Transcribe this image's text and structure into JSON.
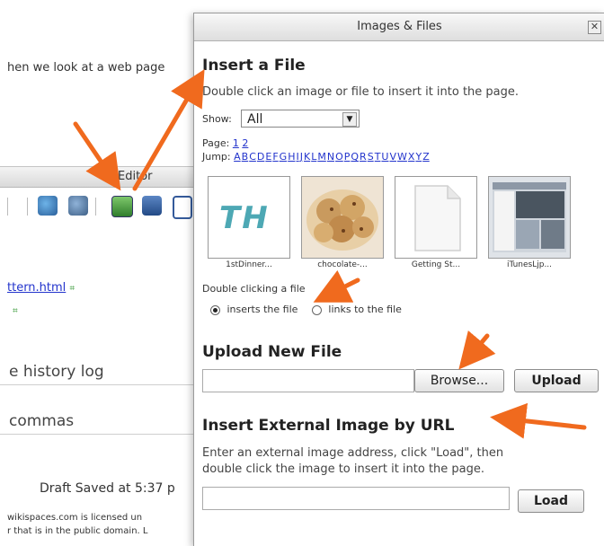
{
  "background": {
    "intro_text": "hen we look at a web page",
    "editor_label": "Editor",
    "link_text": "ttern.html",
    "history_field": "e history log",
    "commas_field": "commas",
    "draft_status": "Draft Saved at 5:37 p",
    "license_line1": "wikispaces.com is licensed un",
    "license_line2": "r that is in the public domain. L"
  },
  "dialog": {
    "title": "Images & Files",
    "close_icon": "close-icon",
    "insert": {
      "heading": "Insert a File",
      "description": "Double click an image or file to insert it into the page.",
      "show_label": "Show:",
      "show_value": "All",
      "page_label": "Page:",
      "pages": [
        "1",
        "2"
      ],
      "jump_label": "Jump:",
      "jump_letters": [
        "A",
        "B",
        "C",
        "D",
        "E",
        "F",
        "G",
        "H",
        "I",
        "J",
        "K",
        "L",
        "M",
        "N",
        "O",
        "P",
        "Q",
        "R",
        "S",
        "T",
        "U",
        "V",
        "W",
        "X",
        "Y",
        "Z"
      ],
      "files": [
        {
          "caption": "1stDinner...",
          "thumb_text": "TH"
        },
        {
          "caption": "chocolate-...",
          "thumb_text": ""
        },
        {
          "caption": "Getting St...",
          "thumb_text": ""
        },
        {
          "caption": "iTunesLjp...",
          "thumb_text": ""
        }
      ],
      "double_click_label": "Double clicking a file",
      "option_inserts": "inserts the file",
      "option_links": "links to the file"
    },
    "upload": {
      "heading": "Upload New File",
      "browse_label": "Browse...",
      "upload_label": "Upload"
    },
    "external": {
      "heading": "Insert External Image by URL",
      "description_line1": "Enter an external image address, click \"Load\", then",
      "description_line2": "double click the image to insert it into the page.",
      "load_label": "Load"
    }
  },
  "colors": {
    "arrow": "#f06a1e",
    "link": "#2233cc",
    "thumb_teal": "#2e9aa8"
  }
}
